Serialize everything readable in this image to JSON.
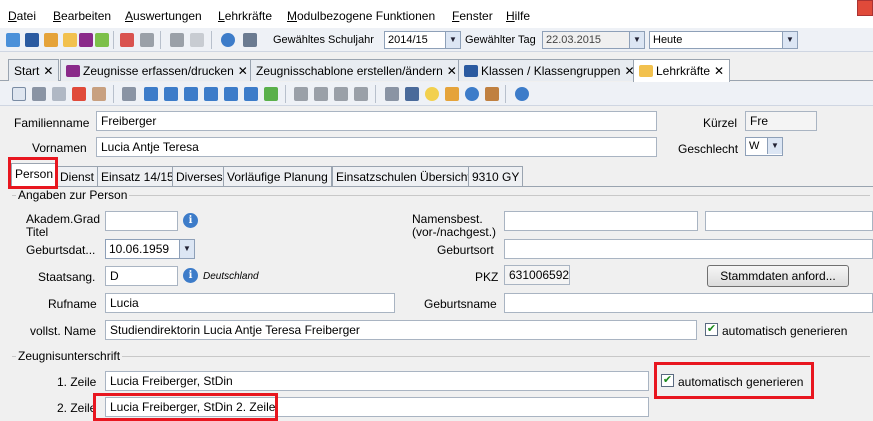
{
  "menu": {
    "items": [
      "Datei",
      "Bearbeiten",
      "Auswertungen",
      "Lehrkräfte",
      "Modulbezogene Funktionen",
      "Fenster",
      "Hilfe"
    ]
  },
  "toolbar": {
    "schuljahr_label": "Gewähltes Schuljahr",
    "schuljahr_value": "2014/15",
    "tag_label": "Gewählter Tag",
    "tag_value": "22.03.2015",
    "heute_value": "Heute"
  },
  "tabs": [
    {
      "label": "Start"
    },
    {
      "label": "Zeugnisse erfassen/drucken"
    },
    {
      "label": "Zeugnisschablone erstellen/ändern"
    },
    {
      "label": "Klassen / Klassengruppen"
    },
    {
      "label": "Lehrkräfte"
    }
  ],
  "header": {
    "familienname_label": "Familienname",
    "familienname_value": "Freiberger",
    "vornamen_label": "Vornamen",
    "vornamen_value": "Lucia Antje Teresa",
    "kuerzel_label": "Kürzel",
    "kuerzel_value": "Fre",
    "geschlecht_label": "Geschlecht",
    "geschlecht_value": "W"
  },
  "inner_tabs": [
    "Person",
    "Dienst",
    "Einsatz 14/15",
    "Diverses",
    "Vorläufige Planung",
    "Einsatzschulen Übersicht",
    "9310 GY"
  ],
  "person": {
    "group_title": "Angaben zur Person",
    "akadem_label": "Akadem.Grad",
    "titel_label": "Titel",
    "namensbest_label": "Namensbest.",
    "vornach_label": "(vor-/nachgest.)",
    "geburtsdat_label": "Geburtsdat...",
    "geburtsdat_value": "10.06.1959",
    "geburtsort_label": "Geburtsort",
    "staatsang_label": "Staatsang.",
    "staatsang_value": "D",
    "staatsang_hint": "Deutschland",
    "pkz_label": "PKZ",
    "pkz_value": "631006592",
    "stammdaten_button": "Stammdaten anford...",
    "rufname_label": "Rufname",
    "rufname_value": "Lucia",
    "geburtsname_label": "Geburtsname",
    "vollst_label": "vollst. Name",
    "vollst_value": "Studiendirektorin Lucia Antje Teresa Freiberger",
    "auto_label": "automatisch generieren"
  },
  "zeugnis": {
    "group_title": "Zeugnisunterschrift",
    "zeile1_label": "1. Zeile",
    "zeile1_value": "Lucia Freiberger, StDin",
    "zeile2_label": "2. Zeile",
    "zeile2_value": "Lucia Freiberger, StDin 2. Zeile",
    "auto_label": "automatisch generieren"
  },
  "colors": {
    "highlight": "#e8161f",
    "accent_blue": "#3d7cc9",
    "check_green": "#1a8a1a"
  }
}
